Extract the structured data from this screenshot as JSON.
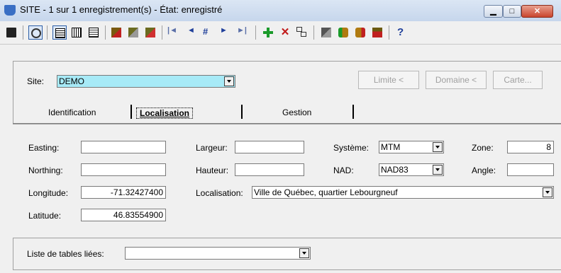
{
  "window": {
    "title": "SITE - 1 sur 1 enregistrement(s) - État: enregistré",
    "min_glyph": "▁",
    "max_glyph": "□",
    "close_glyph": "✕"
  },
  "toolbar": {
    "icons": [
      "save-icon",
      "refresh-icon",
      "form-view-icon",
      "grid-view-icon",
      "detail-view-icon",
      "print-icon",
      "copy-icon",
      "delete-icon",
      "first-record-icon",
      "previous-record-icon",
      "goto-record-icon",
      "next-record-icon",
      "last-record-icon",
      "add-icon",
      "remove-icon",
      "link-icon",
      "export-icon",
      "db-add-icon",
      "db-remove-icon",
      "calculator-icon",
      "help-icon"
    ],
    "nav_first": "|◄",
    "nav_prev": "◄",
    "nav_goto": "#",
    "nav_next": "►",
    "nav_last": "►|",
    "help": "?"
  },
  "site": {
    "label": "Site:",
    "value": "DEMO"
  },
  "buttons": {
    "limite": "Limite <",
    "domaine": "Domaine <",
    "carte": "Carte..."
  },
  "tabs": {
    "identification": "Identification",
    "localisation": "Localisation",
    "gestion": "Gestion"
  },
  "form": {
    "easting_label": "Easting:",
    "easting_value": "",
    "northing_label": "Northing:",
    "northing_value": "",
    "longitude_label": "Longitude:",
    "longitude_value": "-71.32427400",
    "latitude_label": "Latitude:",
    "latitude_value": "46.83554900",
    "largeur_label": "Largeur:",
    "largeur_value": "",
    "hauteur_label": "Hauteur:",
    "hauteur_value": "",
    "systeme_label": "Système:",
    "systeme_value": "MTM",
    "nad_label": "NAD:",
    "nad_value": "NAD83",
    "zone_label": "Zone:",
    "zone_value": "8",
    "angle_label": "Angle:",
    "angle_value": "",
    "localisation_label": "Localisation:",
    "localisation_value": "Ville de Québec, quartier Lebourgneuf"
  },
  "linked": {
    "label": "Liste de tables liées:",
    "value": ""
  }
}
